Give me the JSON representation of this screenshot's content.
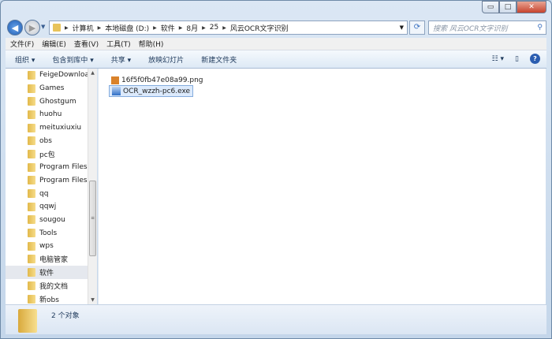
{
  "window": {
    "minimize": "▭",
    "maximize": "□",
    "close": "✕"
  },
  "address": {
    "crumbs": [
      "计算机",
      "本地磁盘 (D:)",
      "软件",
      "8月",
      "25",
      "风云OCR文字识别"
    ],
    "search_placeholder": "搜索 风云OCR文字识别"
  },
  "menu": [
    "文件(F)",
    "编辑(E)",
    "查看(V)",
    "工具(T)",
    "帮助(H)"
  ],
  "toolbar": {
    "organize": "组织 ▾",
    "include": "包含到库中 ▾",
    "share": "共享 ▾",
    "slideshow": "放映幻灯片",
    "new_folder": "新建文件夹"
  },
  "nav": {
    "items": [
      "FeigeDownloa",
      "Games",
      "Ghostgum",
      "huohu",
      "meituxiuxiu",
      "obs",
      "pc包",
      "Program Files",
      "Program Files",
      "qq",
      "qqwj",
      "sougou",
      "Tools",
      "wps",
      "电脑管家",
      "软件",
      "我的文档",
      "新obs"
    ],
    "selected": "软件"
  },
  "files": [
    {
      "name": "16f5f0fb47e08a99.png",
      "type": "png"
    },
    {
      "name": "OCR_wzzh-pc6.exe",
      "type": "exe",
      "selected": true
    }
  ],
  "status": {
    "count": "2 个对象"
  }
}
